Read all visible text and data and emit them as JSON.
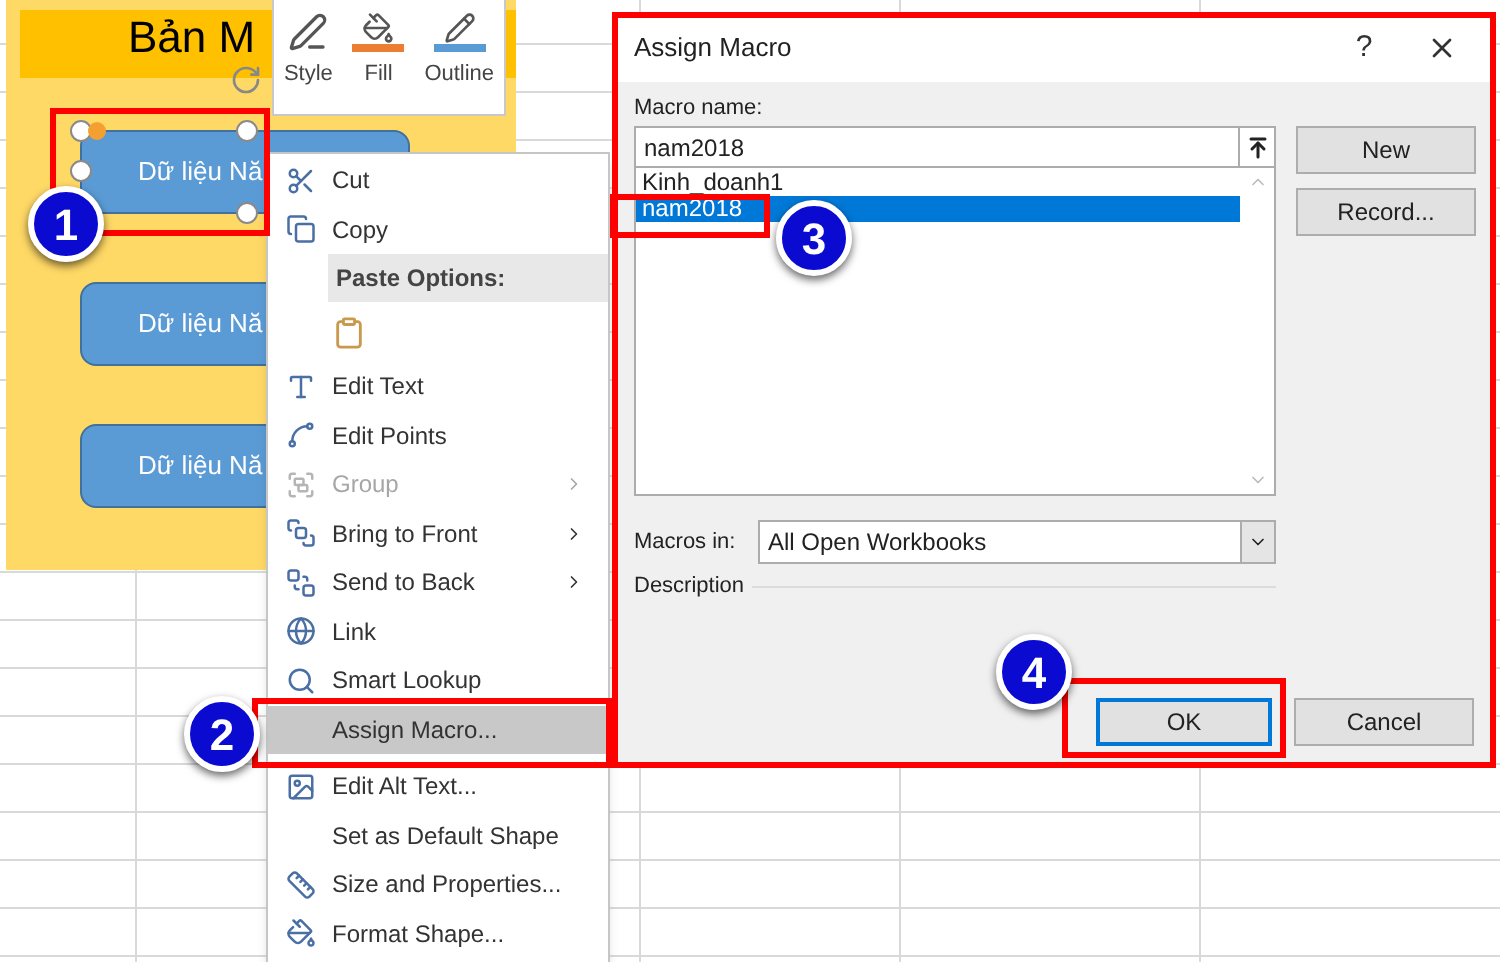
{
  "sheet": {
    "title": "Bản M",
    "shapes": [
      {
        "label": "Dữ liệu Nă",
        "selected": true
      },
      {
        "label": "Dữ liệu Nă",
        "selected": false
      },
      {
        "label": "Dữ liệu Nă",
        "selected": false
      }
    ]
  },
  "mini_toolbar": {
    "items": [
      {
        "label": "Style"
      },
      {
        "label": "Fill"
      },
      {
        "label": "Outline"
      }
    ]
  },
  "context_menu": {
    "items": [
      {
        "kind": "item",
        "label": "Cut",
        "disabled": false,
        "submenu": false,
        "selected": false
      },
      {
        "kind": "item",
        "label": "Copy",
        "disabled": false,
        "submenu": false,
        "selected": false
      },
      {
        "kind": "header",
        "label": "Paste Options:"
      },
      {
        "kind": "paste"
      },
      {
        "kind": "item",
        "label": "Edit Text",
        "disabled": false,
        "submenu": false,
        "selected": false
      },
      {
        "kind": "item",
        "label": "Edit Points",
        "disabled": false,
        "submenu": false,
        "selected": false
      },
      {
        "kind": "item",
        "label": "Group",
        "disabled": true,
        "submenu": true,
        "selected": false
      },
      {
        "kind": "item",
        "label": "Bring to Front",
        "disabled": false,
        "submenu": true,
        "selected": false
      },
      {
        "kind": "item",
        "label": "Send to Back",
        "disabled": false,
        "submenu": true,
        "selected": false
      },
      {
        "kind": "item",
        "label": "Link",
        "disabled": false,
        "submenu": false,
        "selected": false
      },
      {
        "kind": "item",
        "label": "Smart Lookup",
        "disabled": false,
        "submenu": false,
        "selected": false
      },
      {
        "kind": "item",
        "label": "Assign Macro...",
        "disabled": false,
        "submenu": false,
        "selected": true
      },
      {
        "kind": "item",
        "label": "Edit Alt Text...",
        "disabled": false,
        "submenu": false,
        "selected": false
      },
      {
        "kind": "item",
        "label": "Set as Default Shape",
        "disabled": false,
        "submenu": false,
        "selected": false
      },
      {
        "kind": "item",
        "label": "Size and Properties...",
        "disabled": false,
        "submenu": false,
        "selected": false
      },
      {
        "kind": "item",
        "label": "Format Shape...",
        "disabled": false,
        "submenu": false,
        "selected": false
      }
    ]
  },
  "dialog": {
    "title": "Assign Macro",
    "help": "?",
    "macro_name_label": "Macro name:",
    "macro_name_value": "nam2018",
    "macros": [
      {
        "label": "Kinh_doanh1",
        "selected": false
      },
      {
        "label": "nam2018",
        "selected": true
      }
    ],
    "buttons": [
      {
        "label": "New"
      },
      {
        "label": "Record..."
      }
    ],
    "macros_in_label": "Macros in:",
    "macros_in_value": "All Open Workbooks",
    "description_label": "Description",
    "ok": "OK",
    "cancel": "Cancel"
  },
  "callouts": [
    {
      "label": "1"
    },
    {
      "label": "2"
    },
    {
      "label": "3"
    },
    {
      "label": "4"
    }
  ]
}
